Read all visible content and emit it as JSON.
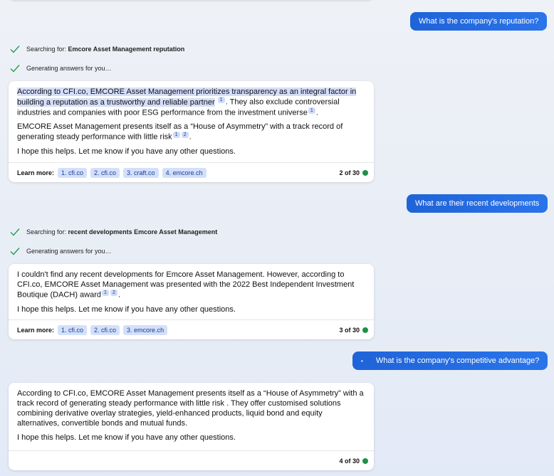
{
  "top_card": {},
  "messages": {
    "q1": "What is the company's reputation?",
    "q2": "What are their recent developments",
    "q3": "What is the company's competitive advantage?"
  },
  "status1": {
    "search_prefix": "Searching for: ",
    "search_term": "Emcore Asset Management reputation",
    "generating": "Generating answers for you…"
  },
  "status2": {
    "search_prefix": "Searching for: ",
    "search_term": "recent developments Emcore Asset Management",
    "generating": "Generating answers for you…"
  },
  "answer1": {
    "p1_highlight": "According to CFI.co, EMCORE Asset Management prioritizes transparency as an integral factor in building a reputation as a trustworthy and reliable partner",
    "p1_cite": "1",
    "p1_rest": ". They also exclude controversial industries and companies with poor ESG performance from the investment universe",
    "p1_cite2": "1",
    "p1_end": ".",
    "p2": "EMCORE Asset Management presents itself as a “House of Asymmetry” with a track record of generating steady performance with little risk",
    "p2_cite1": "1",
    "p2_cite2": "2",
    "p2_end": ".",
    "p3": "I hope this helps. Let me know if you have any other questions.",
    "learn_more": "Learn more:",
    "links": [
      "1. cfi.co",
      "2. cfi.co",
      "3. craft.co",
      "4. emcore.ch"
    ],
    "count": "2 of 30"
  },
  "answer2": {
    "p1": "I couldn't find any recent developments for Emcore Asset Management. However, according to CFI.co, EMCORE Asset Management was presented with the 2022 Best Independent Investment Boutique (DACH) award",
    "p1_cite1": "1",
    "p1_cite2": "2",
    "p1_end": ".",
    "p2": "I hope this helps. Let me know if you have any other questions.",
    "learn_more": "Learn more:",
    "links": [
      "1. cfi.co",
      "2. cfi.co",
      "3. emcore.ch"
    ],
    "count": "3 of 30"
  },
  "answer3": {
    "p1": "According to CFI.co, EMCORE Asset Management presents itself as a “House of Asymmetry” with a track record of generating steady performance with little risk . They offer customised solutions combining derivative overlay strategies, yield-enhanced products, liquid bond and equity alternatives, convertible bonds and mutual funds.",
    "p2": "I hope this helps. Let me know if you have any other questions.",
    "count": "4 of 30"
  },
  "colors": {
    "user_bubble": "#2a6ce0",
    "highlight": "#d5def9",
    "status_dot": "#1f8f4a",
    "check": "#2b9a4f"
  }
}
